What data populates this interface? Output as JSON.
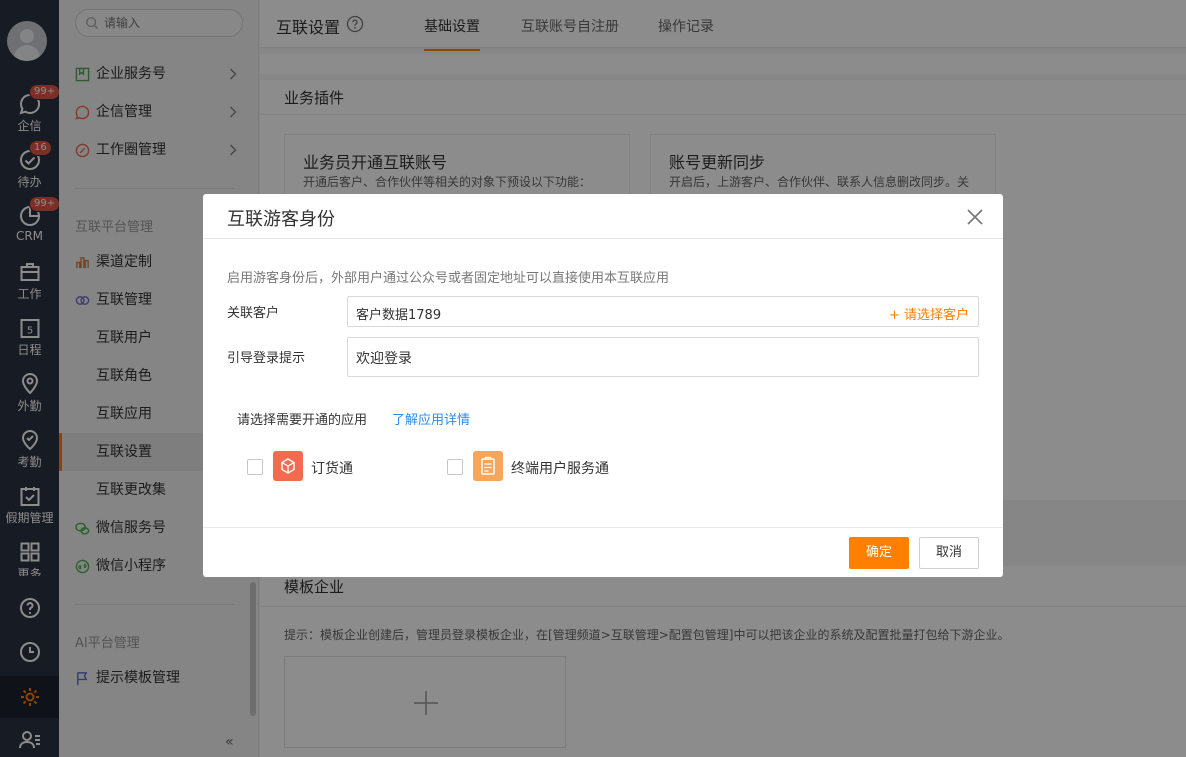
{
  "rail": {
    "items": [
      {
        "label": "企信",
        "badge": "99+"
      },
      {
        "label": "待办",
        "badge": "16"
      },
      {
        "label": "CRM",
        "badge": "99+"
      },
      {
        "label": "工作"
      },
      {
        "label": "日程",
        "calendar_day": "5"
      },
      {
        "label": "外勤"
      },
      {
        "label": "考勤"
      },
      {
        "label": "假期管理"
      },
      {
        "label": "更多"
      }
    ]
  },
  "nav": {
    "search_placeholder": "请输入",
    "top_items": [
      "企业服务号",
      "企信管理",
      "工作圈管理"
    ],
    "group1": "互联平台管理",
    "group1_items": [
      "渠道定制",
      "互联管理",
      "互联用户",
      "互联角色",
      "互联应用",
      "互联设置",
      "互联更改集",
      "微信服务号",
      "微信小程序"
    ],
    "group2": "AI平台管理",
    "group2_items": [
      "提示模板管理"
    ],
    "collapse": "«"
  },
  "header": {
    "title": "互联设置",
    "tabs": [
      "基础设置",
      "互联账号自注册",
      "操作记录"
    ]
  },
  "main": {
    "plugins_title": "业务插件",
    "card1": {
      "title": "业务员开通互联账号",
      "desc": "开通后客户、合作伙伴等相关的对象下预设以下功能："
    },
    "card2": {
      "title": "账号更新同步",
      "desc": "开启后，上游客户、合作伙伴、联系人信息删改同步。关"
    },
    "template_title": "模板企业",
    "template_hint": "提示：模板企业创建后，管理员登录模板企业，在[管理频道>互联管理>配置包管理]中可以把该企业的系统及配置批量打包给下游企业。"
  },
  "modal": {
    "title": "互联游客身份",
    "desc": "启用游客身份后，外部用户通过公众号或者固定地址可以直接使用本互联应用",
    "customer_label": "关联客户",
    "customer_value": "客户数据1789",
    "customer_action": "+ 请选择客户",
    "login_label": "引导登录提示",
    "login_value": "欢迎登录",
    "apps_label": "请选择需要开通的应用",
    "apps_link": "了解应用详情",
    "apps": [
      {
        "name": "订货通",
        "color": "#f26b4f"
      },
      {
        "name": "终端用户服务通",
        "color": "#f6a55a"
      }
    ],
    "ok": "确定",
    "cancel": "取消"
  },
  "colors": {
    "accent": "#ff8000",
    "link": "#2d8cf0",
    "rail_bg": "#2a3240"
  }
}
